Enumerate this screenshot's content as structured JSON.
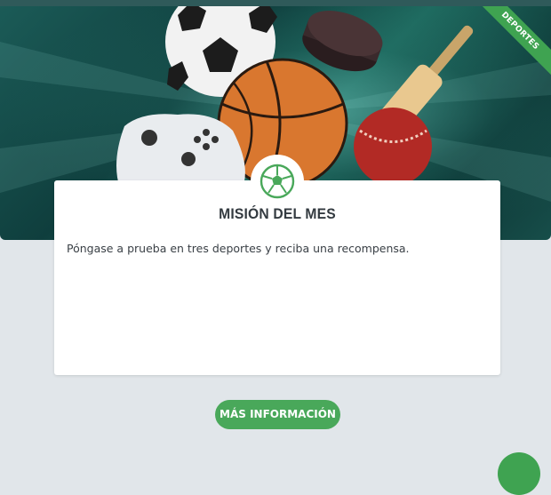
{
  "hero": {
    "ribbon_label": "DEPORTES"
  },
  "card": {
    "title": "MISIÓN DEL MES",
    "description": "Póngase a prueba en tres deportes y reciba una recompensa.",
    "icon": "soccer-ball-icon"
  },
  "cta": {
    "label": "MÁS INFORMACIÓN"
  },
  "colors": {
    "accent": "#49a85a",
    "background": "#e1e6ea",
    "hero_dark": "#0f3e3d",
    "title_text": "#333a40"
  }
}
